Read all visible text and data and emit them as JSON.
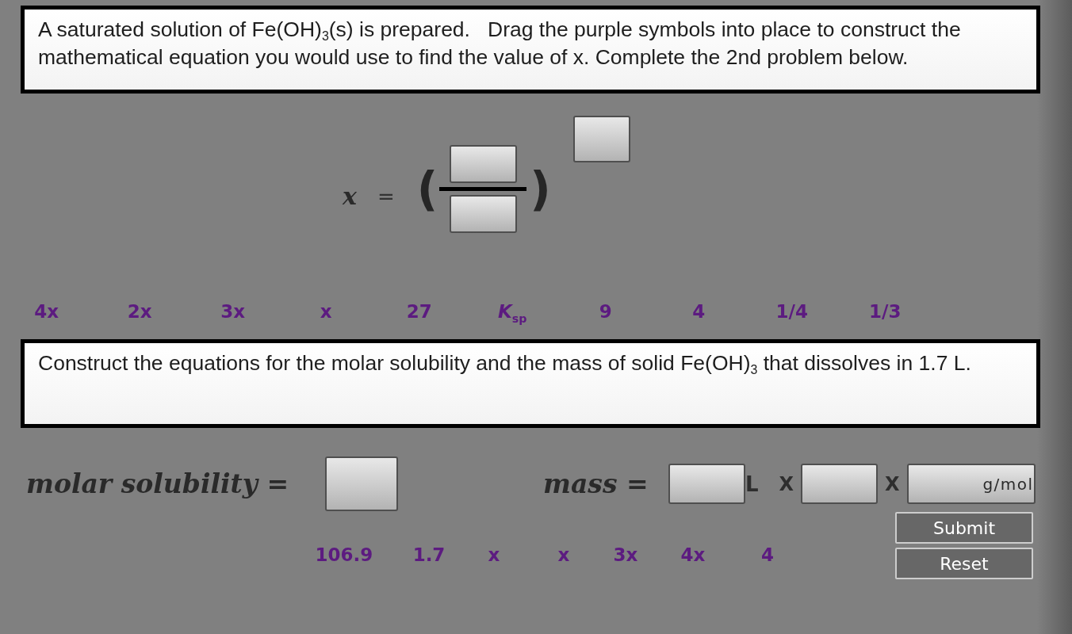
{
  "instructions": {
    "text": "A saturated solution of Fe(OH)$_{3}$(s) is prepared.   Drag the purple symbols into place to construct the mathematical equation you would use to find the value of x. Complete the 2nd problem below."
  },
  "equation": {
    "variable": "x",
    "equals": "=",
    "open_paren": "(",
    "close_paren": ")"
  },
  "symbols_row_1": [
    "4x",
    "2x",
    "3x",
    "x",
    "27",
    "*K*$_{sp}$",
    "9",
    "4",
    "1/4",
    "1/3"
  ],
  "problem_2": {
    "text": "Construct the equations for the molar solubility and the mass of solid Fe(OH)$_{3}$ that dissolves in 1.7 L.",
    "molar_solubility_label": "molar solubility =",
    "mass_label": "mass =",
    "mass_terms": [
      {
        "kind": "slot"
      },
      {
        "kind": "unit",
        "text": "L"
      },
      {
        "kind": "operator",
        "text": "X"
      },
      {
        "kind": "slot"
      },
      {
        "kind": "operator",
        "text": "X"
      },
      {
        "kind": "slot",
        "unit": "g/mol"
      }
    ]
  },
  "symbols_row_2": [
    "106.9",
    "1.7",
    "x",
    "x",
    "3x",
    "4x",
    "4"
  ],
  "buttons": [
    "Submit",
    "Reset"
  ]
}
